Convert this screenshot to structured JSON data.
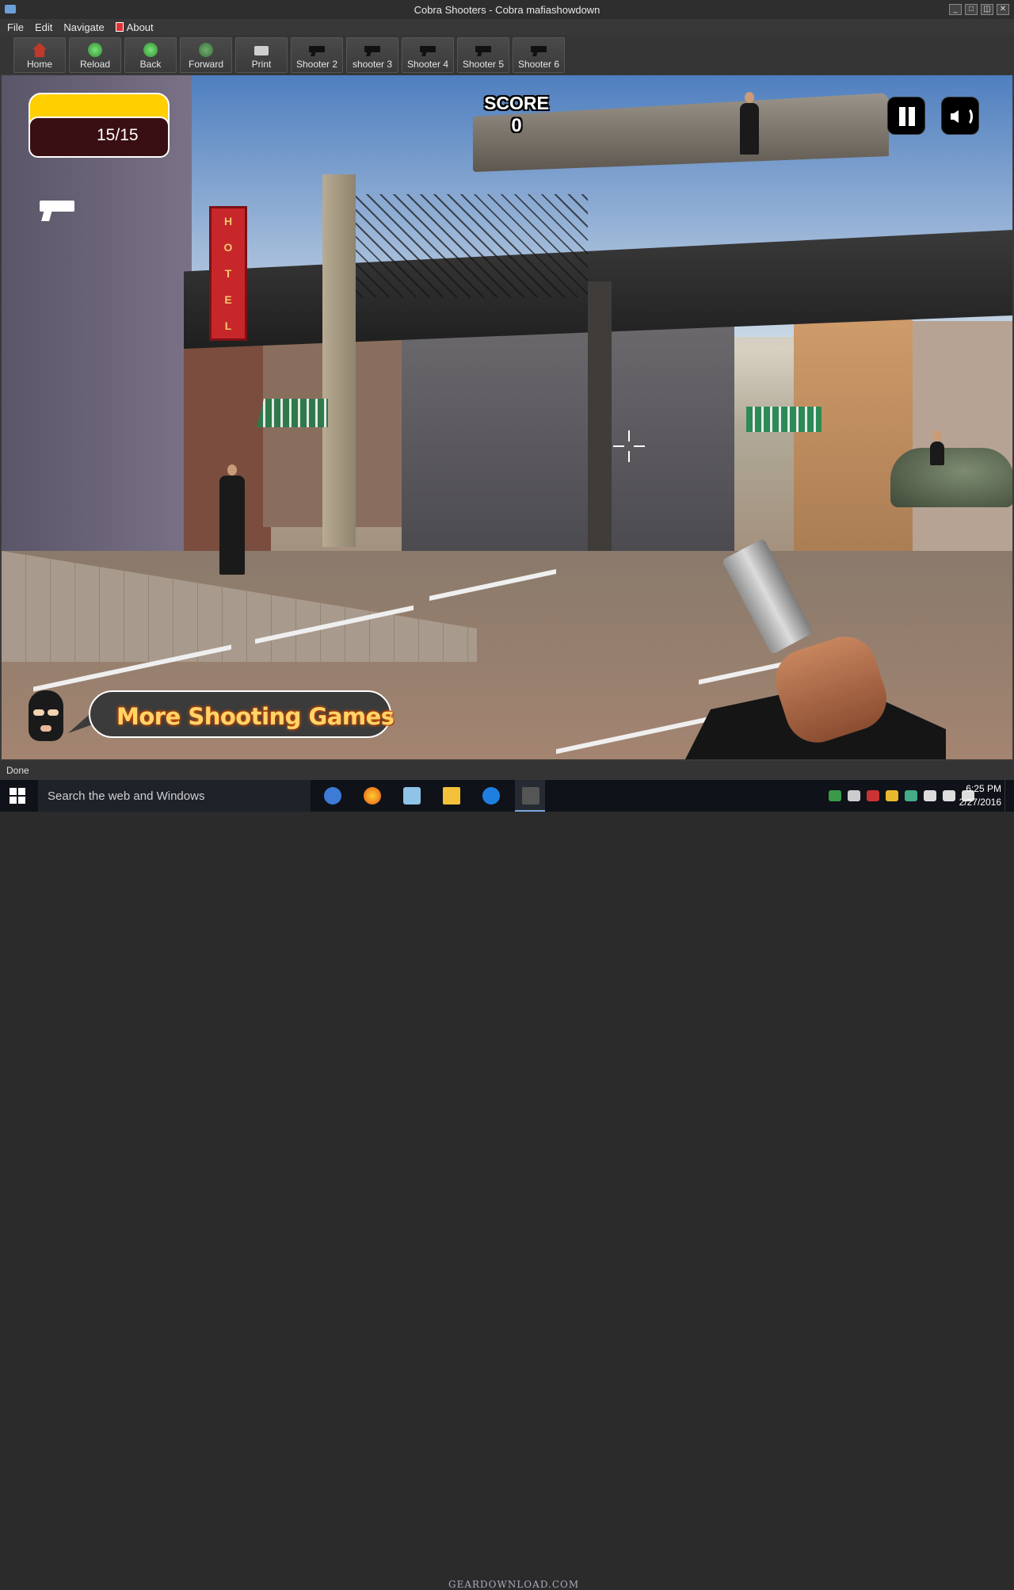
{
  "window": {
    "title": "Cobra Shooters - Cobra mafiashowdown",
    "controls": [
      "_",
      "□",
      "◫",
      "✕"
    ]
  },
  "menu": {
    "items": [
      "File",
      "Edit",
      "Navigate"
    ],
    "about": "About"
  },
  "toolbar": {
    "home": "Home",
    "reload": "Reload",
    "back": "Back",
    "forward": "Forward",
    "print": "Print",
    "shooter2": "Shooter 2",
    "shooter3": "shooter 3",
    "shooter4": "Shooter 4",
    "shooter5": "Shooter 5",
    "shooter6": "Shooter 6"
  },
  "game": {
    "ammo": "15/15",
    "score_label": "SCORE",
    "score_value": "0",
    "hotel_sign": [
      "H",
      "O",
      "T",
      "E",
      "L"
    ],
    "more_games": "More Shooting Games"
  },
  "status": {
    "text": "Done"
  },
  "taskbar": {
    "search_placeholder": "Search the web and Windows",
    "time": "6:25 PM",
    "date": "2/27/2016",
    "watermark": "GEARDOWNLOAD.COM"
  },
  "colors": {
    "ammo_yellow": "#ffcf00",
    "ammo_dark": "#3a0f13",
    "more_games_text": "#ffd56a"
  }
}
